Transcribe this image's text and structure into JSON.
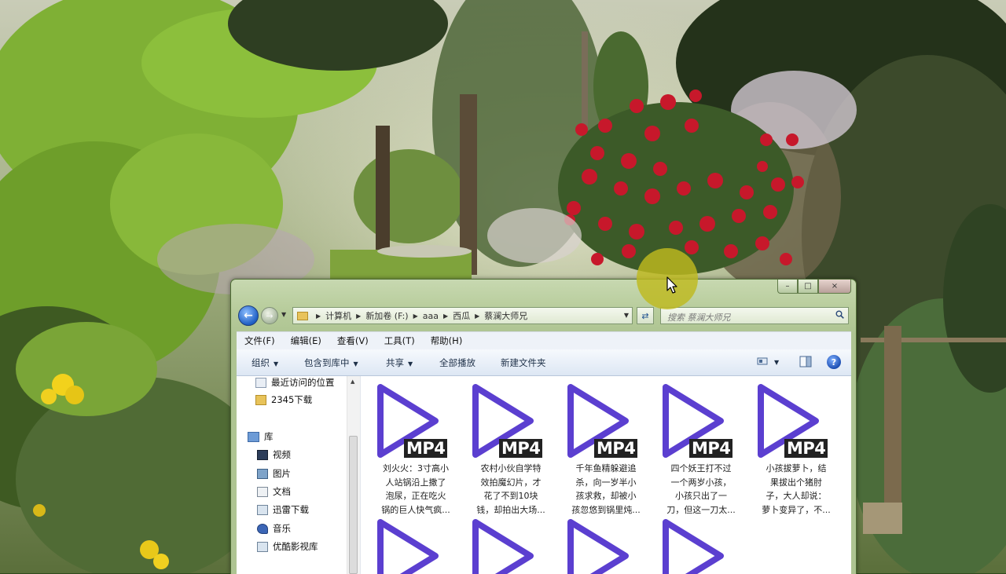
{
  "window": {
    "controls": {
      "minimize": "–",
      "maximize": "□",
      "close": "×"
    },
    "address_path": [
      "计算机",
      "新加卷 (F:)",
      "aaa",
      "西瓜",
      "蔡澜大师兄"
    ],
    "search_placeholder": "搜索 蔡澜大师兄"
  },
  "menu": [
    "文件(F)",
    "编辑(E)",
    "查看(V)",
    "工具(T)",
    "帮助(H)"
  ],
  "toolbar": {
    "organize": "组织",
    "include_in_library": "包含到库中",
    "share": "共享",
    "play_all": "全部播放",
    "new_folder": "新建文件夹"
  },
  "nav_pane": {
    "recent_places": "最近访问的位置",
    "downloads_2345": "2345下载",
    "library": "库",
    "video": "视频",
    "pictures": "图片",
    "documents": "文档",
    "xunlei": "迅雷下载",
    "music": "音乐",
    "youku": "优酷影视库"
  },
  "files": [
    {
      "badge": "MP4",
      "lines": [
        "刘火火：3寸高小",
        "人站锅沿上撒了",
        "泡尿，正在吃火",
        "锅的巨人快气疯..."
      ]
    },
    {
      "badge": "MP4",
      "lines": [
        "农村小伙自学特",
        "效拍魔幻片，才",
        "花了不到10块",
        "钱，却拍出大场..."
      ]
    },
    {
      "badge": "MP4",
      "lines": [
        "千年鱼精躲避追",
        "杀，向一岁半小",
        "孩求救，却被小",
        "孩忽悠到锅里炖..."
      ]
    },
    {
      "badge": "MP4",
      "lines": [
        "四个妖王打不过",
        "一个两岁小孩，",
        "小孩只出了一",
        "刀，但这一刀太..."
      ]
    },
    {
      "badge": "MP4",
      "lines": [
        "小孩拔萝卜，结",
        "果拔出个猪肘",
        "子，大人却说：",
        "萝卜变异了，不..."
      ]
    },
    {
      "badge": "",
      "lines": []
    },
    {
      "badge": "",
      "lines": []
    },
    {
      "badge": "",
      "lines": []
    },
    {
      "badge": "",
      "lines": []
    }
  ],
  "colors": {
    "play_icon": "#5b3fd0",
    "window_frame": "#b7cc9b",
    "cursor_highlight": "#bebb1e"
  }
}
